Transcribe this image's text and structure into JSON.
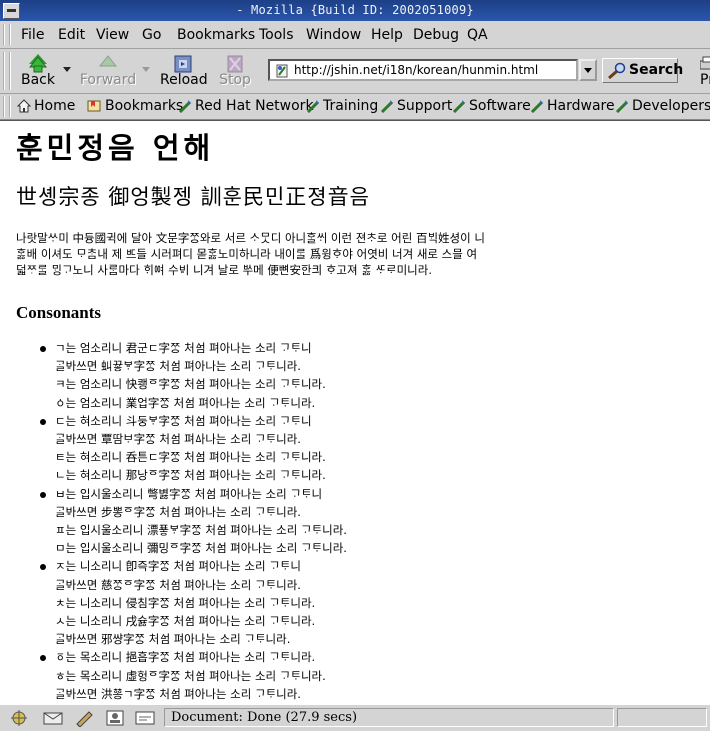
{
  "window": {
    "title": "- Mozilla {Build ID: 2002051009}"
  },
  "menu": [
    "File",
    "Edit",
    "View",
    "Go",
    "Bookmarks",
    "Tools",
    "Window",
    "Help",
    "Debug",
    "QA"
  ],
  "nav": {
    "back": "Back",
    "forward": "Forward",
    "reload": "Reload",
    "stop": "Stop",
    "url": "http://jshin.net/i18n/korean/hunmin.html",
    "search": "Search",
    "print_partial": "Pr"
  },
  "bookmarks": [
    "Home",
    "Bookmarks",
    "Red Hat Network",
    "Training",
    "Support",
    "Software",
    "Hardware",
    "Developers"
  ],
  "page": {
    "title": "훈민정음 언해",
    "subtitle": "世솅宗종 御엉製젱 訓훈民민正졍音음",
    "intro": [
      "나랏말ᄊᆞ미 中듕國귁에 달아 文문字ᄍᆞᆼ와로 서르 ᄉᆞᄆᆞᆺ디 아니ᄒᆞᆯᄊᆡ 이런 젼ᄎᆞ로 어린 百ᄇᆡᆨ姓셩이 니",
      "ᄒᆞᇙ배 이셔도 ᄆᆞᄎᆞᆷ내 제 ᄠᅳ들 시러펴디 몯ᄒᆞᇙ노미하니라 내이ᄅᆞᆯ 爲윙ᄒᆞ야 어엿비 너겨 새로 스믈 여",
      "덟ᄍᆞᄅᆞᆯ ᄆᆡᆼᄀᆞ노니 사ᄅᆞᆷ마다 ᄒᆡᅇᅧ 수ᄫᅵ 니겨 날로 ᄡᅮ메 便뼌安ᅙᅡᆫ킈 ᄒᆞ고져 ᄒᆞᇙ ᄯᆞᄅᆞ미니라."
    ],
    "section_heading": "Consonants",
    "consonants": [
      {
        "bullet": true,
        "text": "ㄱ는 엄소리니 君군ㄷ字ᄍᆞᆼ 처ᅀᅥᆷ 펴아나는 소리 ᄀᆞᄐᆞ니"
      },
      {
        "bullet": false,
        "text": "ᄀᆞᆯᄫᅡ쓰면 虯끃ᄫᆞ字ᄍᆞᆼ 처ᅀᅥᆷ 펴아나는 소리 ᄀᆞᄐᆞ니라."
      },
      {
        "bullet": false,
        "text": "ㅋ는 엄소리니 快쾡ᅙ字ᄍᆞᆼ 처ᅀᅥᆷ 펴아나는 소리 ᄀᆞᄐᆞ니라."
      },
      {
        "bullet": false,
        "text": "ㆁ는 엄소리니 業업字ᄍᆞᆼ 처ᅀᅥᆷ 펴아나는 소리 ᄀᆞᄐᆞ니라."
      },
      {
        "bullet": true,
        "text": "ㄷ는 혀소리니 斗둥ᄫᆞ字ᄍᆞᆼ 처ᅀᅥᆷ 펴아나는 소리 ᄀᆞᄐᆞ니"
      },
      {
        "bullet": false,
        "text": "ᄀᆞᆯᄫᅡ쓰면 覃땀ᄇᆞ字ᄍᆞᆼ 처ᅀᅥᆷ 펴ᅀᅡ나는 소리 ᄀᆞᄐᆞ니라."
      },
      {
        "bullet": false,
        "text": "ㅌ는 혀소리니 呑튼ㄷ字ᄍᆞᆼ 처ᅀᅥᆷ 펴아나는 소리 ᄀᆞᄐᆞ니라."
      },
      {
        "bullet": false,
        "text": "ㄴ는 혀소리니 那낭ᅙ字ᄍᆞᆼ 처ᅀᅥᆷ 펴아나는 소리 ᄀᆞᄐᆞ니라."
      },
      {
        "bullet": true,
        "text": "ㅂ는 입시울소리니 彆볋字ᄍᆞᆼ 처ᅀᅥᆷ 펴아나는 소리 ᄀᆞᄐᆞ니"
      },
      {
        "bullet": false,
        "text": "ᄀᆞᆯᄫᅡ쓰면 步뽕ᅙ字ᄍᆞᆼ 처ᅀᅥᆷ 펴아나는 소리 ᄀᆞᄐᆞ니라."
      },
      {
        "bullet": false,
        "text": "ㅍ는 입시울소리니 漂푷ᄫᆞ字ᄍᆞᆼ 처ᅀᅥᆷ 펴아나는 소리 ᄀᆞᄐᆞ니라."
      },
      {
        "bullet": false,
        "text": "ㅁ는 입시울소리니 彌밍ᅙ字ᄍᆞᆼ 처ᅀᅥᆷ 펴아나는 소리 ᄀᆞᄐᆞ니라."
      },
      {
        "bullet": true,
        "text": "ㅈ는 니소리니 卽즉字ᄍᆞᆼ 처ᅀᅥᆷ 펴아나는 소리 ᄀᆞᄐᆞ니"
      },
      {
        "bullet": false,
        "text": "ᄀᆞᆯᄫᅡ쓰면 慈ᄍᆞᆼᅙ字ᄍᆞᆼ 처ᅀᅥᆷ 펴아나는 소리 ᄀᆞᄐᆞ니라."
      },
      {
        "bullet": false,
        "text": "ㅊ는 니소리니 侵침字ᄍᆞᆼ 처ᅀᅥᆷ 펴아나는 소리 ᄀᆞᄐᆞ니라."
      },
      {
        "bullet": false,
        "text": "ㅅ는 니소리니 戌슗字ᄍᆞᆼ 처ᅀᅥᆷ 펴아나는 소리 ᄀᆞᄐᆞ니라."
      },
      {
        "bullet": false,
        "text": "ᄀᆞᆯᄫᅡ쓰면 邪썅字ᄍᆞᆼ 처ᅀᅥᆷ 펴아나는 소리 ᄀᆞᄐᆞ니라."
      },
      {
        "bullet": true,
        "text": "ㆆ는 목소리니 挹흡字ᄍᆞᆼ 처ᅀᅥᆷ 펴아나는 소리 ᄀᆞᄐᆞ니라."
      },
      {
        "bullet": false,
        "text": "ㅎ는 목소리니 虛헝ᅙ字ᄍᆞᆼ 처ᅀᅥᆷ 펴아나는 소리 ᄀᆞᄐᆞ니라."
      },
      {
        "bullet": false,
        "text": "ᄀᆞᆯᄫᅡ쓰면 洪ᅘᅩᆼㄱ字ᄍᆞᆼ 처ᅀᅥᆷ 펴아나는 소리 ᄀᆞᄐᆞ니라."
      }
    ]
  },
  "status": {
    "text": "Document: Done (27.9 secs)"
  },
  "colors": {
    "titlebar": "#1d3f86",
    "chrome": "#d4d4d4",
    "page_bg": "#ffffff"
  }
}
